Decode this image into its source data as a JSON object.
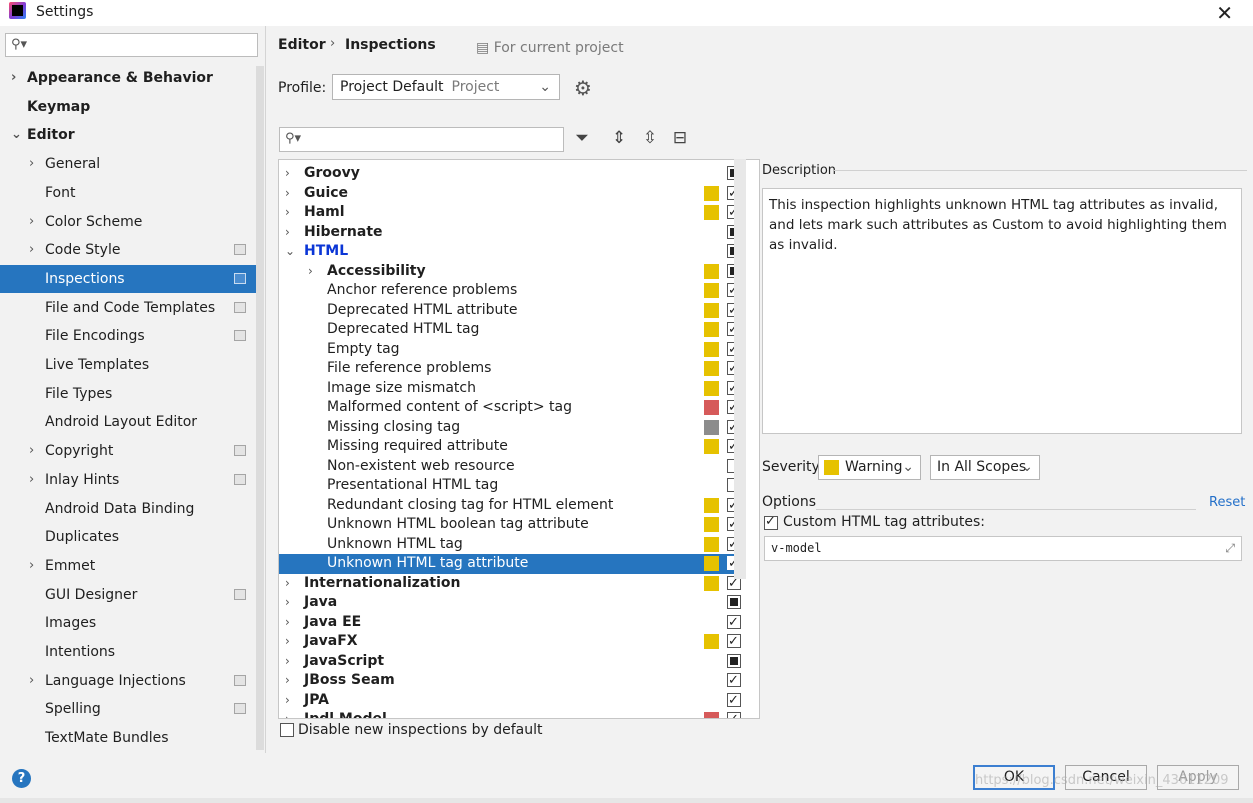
{
  "window": {
    "title": "Settings",
    "close_icon": "close-icon"
  },
  "sidebar": {
    "search_placeholder": "",
    "items": [
      {
        "label": "Appearance & Behavior",
        "bold": true,
        "level": 0,
        "expandable": true,
        "expanded": false
      },
      {
        "label": "Keymap",
        "bold": true,
        "level": 0,
        "expandable": false
      },
      {
        "label": "Editor",
        "bold": true,
        "level": 0,
        "expandable": true,
        "expanded": true
      },
      {
        "label": "General",
        "level": 1,
        "expandable": true
      },
      {
        "label": "Font",
        "level": 1
      },
      {
        "label": "Color Scheme",
        "level": 1,
        "expandable": true
      },
      {
        "label": "Code Style",
        "level": 1,
        "expandable": true,
        "project_icon": true
      },
      {
        "label": "Inspections",
        "level": 1,
        "selected": true,
        "project_icon": true
      },
      {
        "label": "File and Code Templates",
        "level": 1,
        "project_icon": true
      },
      {
        "label": "File Encodings",
        "level": 1,
        "project_icon": true
      },
      {
        "label": "Live Templates",
        "level": 1
      },
      {
        "label": "File Types",
        "level": 1
      },
      {
        "label": "Android Layout Editor",
        "level": 1
      },
      {
        "label": "Copyright",
        "level": 1,
        "expandable": true,
        "project_icon": true
      },
      {
        "label": "Inlay Hints",
        "level": 1,
        "expandable": true,
        "project_icon": true
      },
      {
        "label": "Android Data Binding",
        "level": 1
      },
      {
        "label": "Duplicates",
        "level": 1
      },
      {
        "label": "Emmet",
        "level": 1,
        "expandable": true
      },
      {
        "label": "GUI Designer",
        "level": 1,
        "project_icon": true
      },
      {
        "label": "Images",
        "level": 1
      },
      {
        "label": "Intentions",
        "level": 1
      },
      {
        "label": "Language Injections",
        "level": 1,
        "expandable": true,
        "project_icon": true
      },
      {
        "label": "Spelling",
        "level": 1,
        "project_icon": true
      },
      {
        "label": "TextMate Bundles",
        "level": 1
      }
    ]
  },
  "header": {
    "breadcrumb": [
      "Editor",
      "Inspections"
    ],
    "for_current_project": "For current project"
  },
  "profile": {
    "label": "Profile:",
    "value": "Project Default",
    "sub": "Project"
  },
  "inspections": {
    "filter_placeholder": "",
    "toolbar_icons": [
      "filter-icon",
      "expand-all-icon",
      "collapse-all-icon",
      "reset-to-default-icon"
    ],
    "colors": {
      "warning": "#e6c200",
      "error": "#d65a5a",
      "weak": "#8c8c8c"
    },
    "rows": [
      {
        "label": "Groovy",
        "level": 0,
        "bold": true,
        "state": "partial",
        "sev": null
      },
      {
        "label": "Guice",
        "level": 0,
        "bold": true,
        "state": "checked",
        "sev": "warning"
      },
      {
        "label": "Haml",
        "level": 0,
        "bold": true,
        "state": "checked",
        "sev": "warning"
      },
      {
        "label": "Hibernate",
        "level": 0,
        "bold": true,
        "state": "partial",
        "sev": null
      },
      {
        "label": "HTML",
        "level": 0,
        "bold": true,
        "blue": true,
        "expanded": true,
        "state": "partial",
        "sev": null
      },
      {
        "label": "Accessibility",
        "level": 1,
        "bold": true,
        "state": "partial",
        "sev": "warning"
      },
      {
        "label": "Anchor reference problems",
        "level": 1,
        "leaf": true,
        "state": "checked",
        "sev": "warning"
      },
      {
        "label": "Deprecated HTML attribute",
        "level": 1,
        "leaf": true,
        "state": "checked",
        "sev": "warning"
      },
      {
        "label": "Deprecated HTML tag",
        "level": 1,
        "leaf": true,
        "state": "checked",
        "sev": "warning"
      },
      {
        "label": "Empty tag",
        "level": 1,
        "leaf": true,
        "state": "checked",
        "sev": "warning"
      },
      {
        "label": "File reference problems",
        "level": 1,
        "leaf": true,
        "state": "checked",
        "sev": "warning"
      },
      {
        "label": "Image size mismatch",
        "level": 1,
        "leaf": true,
        "state": "checked",
        "sev": "warning"
      },
      {
        "label": "Malformed content of <script> tag",
        "level": 1,
        "leaf": true,
        "state": "checked",
        "sev": "error"
      },
      {
        "label": "Missing closing tag",
        "level": 1,
        "leaf": true,
        "state": "checked",
        "sev": "weak"
      },
      {
        "label": "Missing required attribute",
        "level": 1,
        "leaf": true,
        "state": "checked",
        "sev": "warning"
      },
      {
        "label": "Non-existent web resource",
        "level": 1,
        "leaf": true,
        "state": "unchecked",
        "sev": null
      },
      {
        "label": "Presentational HTML tag",
        "level": 1,
        "leaf": true,
        "state": "unchecked",
        "sev": null
      },
      {
        "label": "Redundant closing tag for HTML element",
        "level": 1,
        "leaf": true,
        "state": "checked",
        "sev": "warning"
      },
      {
        "label": "Unknown HTML boolean tag attribute",
        "level": 1,
        "leaf": true,
        "state": "checked",
        "sev": "warning"
      },
      {
        "label": "Unknown HTML tag",
        "level": 1,
        "leaf": true,
        "state": "checked",
        "sev": "warning"
      },
      {
        "label": "Unknown HTML tag attribute",
        "level": 1,
        "leaf": true,
        "selected": true,
        "state": "checked",
        "sev": "warning"
      },
      {
        "label": "Internationalization",
        "level": 0,
        "bold": true,
        "state": "checked",
        "sev": "warning"
      },
      {
        "label": "Java",
        "level": 0,
        "bold": true,
        "state": "partial",
        "sev": null
      },
      {
        "label": "Java EE",
        "level": 0,
        "bold": true,
        "state": "checked",
        "sev": null
      },
      {
        "label": "JavaFX",
        "level": 0,
        "bold": true,
        "state": "checked",
        "sev": "warning"
      },
      {
        "label": "JavaScript",
        "level": 0,
        "bold": true,
        "state": "partial",
        "sev": null
      },
      {
        "label": "JBoss Seam",
        "level": 0,
        "bold": true,
        "state": "checked",
        "sev": null
      },
      {
        "label": "JPA",
        "level": 0,
        "bold": true,
        "state": "checked",
        "sev": null
      },
      {
        "label": "Jpdl Model",
        "level": 0,
        "bold": true,
        "state": "checked",
        "sev": "error"
      }
    ],
    "disable_new_label": "Disable new inspections by default"
  },
  "description": {
    "label": "Description",
    "text": "This inspection highlights unknown HTML tag attributes as invalid, and lets mark such attributes as Custom to avoid highlighting them as invalid."
  },
  "severity": {
    "label": "Severity:",
    "value": "Warning",
    "scope": "In All Scopes"
  },
  "options": {
    "label": "Options",
    "reset": "Reset",
    "custom_attrs_label": "Custom HTML tag attributes:",
    "custom_attrs_value": "v-model"
  },
  "footer": {
    "help": "?",
    "ok": "OK",
    "cancel": "Cancel",
    "apply": "Apply",
    "watermark": "https://blog.csdn.net/weixin_43611209"
  }
}
